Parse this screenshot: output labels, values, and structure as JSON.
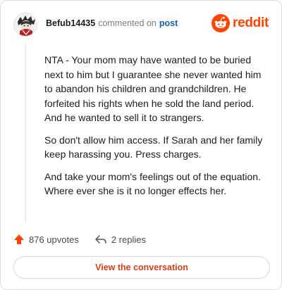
{
  "header": {
    "username": "Befub14435",
    "action_text": "commented on",
    "post_link": "post",
    "brand_name": "reddit",
    "brand_color": "#ff4500",
    "avatar_icon": "anime-character-avatar",
    "brand_icon": "reddit-snoo-icon"
  },
  "comment": {
    "paragraphs": [
      "NTA - Your mom may have wanted to be buried next to him but I guarantee she never wanted him to abandon his children and grandchildren. He forfeited his rights when he sold the land period. And he wanted to sell it to strangers.",
      "So don't allow him access. If Sarah and her family keep harassing you. Press charges.",
      "And take your mom's feelings out of the equation. Where ever she is it no longer effects her."
    ]
  },
  "actions": {
    "upvotes": "876 upvotes",
    "replies": "2 replies",
    "upvote_icon": "upvote-arrow-icon",
    "reply_icon": "reply-arrow-icon",
    "upvote_color": "#ff4500"
  },
  "footer": {
    "view_conversation": "View the conversation",
    "accent_color": "#d4401c"
  }
}
